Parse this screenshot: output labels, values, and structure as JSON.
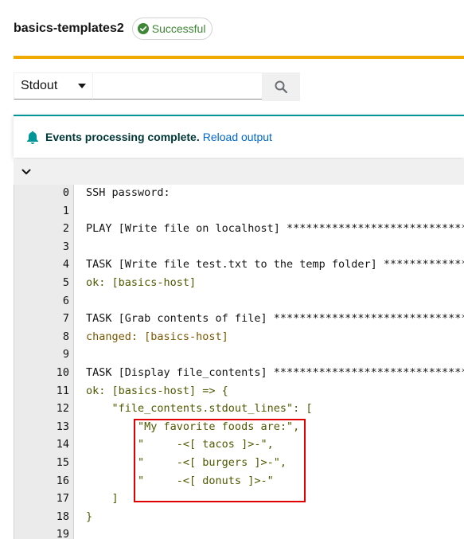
{
  "header": {
    "title": "basics-templates2",
    "status": "Successful"
  },
  "colors": {
    "success": "#3e8635",
    "progress": "#f0ab00",
    "alert_accent": "#009596",
    "link": "#0066cc",
    "highlight": "#e00000"
  },
  "toolbar": {
    "filter_selected": "Stdout",
    "search_value": ""
  },
  "alert": {
    "title": "Events processing complete.",
    "link": "Reload output"
  },
  "output": {
    "lines": [
      {
        "n": "0",
        "text": "SSH password:",
        "style": "default"
      },
      {
        "n": "1",
        "text": "",
        "style": "default"
      },
      {
        "n": "2",
        "text": "PLAY [Write file on localhost] ******************************************",
        "style": "default"
      },
      {
        "n": "3",
        "text": "",
        "style": "default"
      },
      {
        "n": "4",
        "text": "TASK [Write file test.txt to the temp folder] ****************************",
        "style": "default"
      },
      {
        "n": "5",
        "text": "ok: [basics-host]",
        "style": "ok"
      },
      {
        "n": "6",
        "text": "",
        "style": "default"
      },
      {
        "n": "7",
        "text": "TASK [Grab contents of file] ********************************************",
        "style": "default"
      },
      {
        "n": "8",
        "text": "changed: [basics-host]",
        "style": "changed"
      },
      {
        "n": "9",
        "text": "",
        "style": "default"
      },
      {
        "n": "10",
        "text": "TASK [Display file_contents] *********************************************",
        "style": "default"
      },
      {
        "n": "11",
        "text": "ok: [basics-host] => {",
        "style": "ok"
      },
      {
        "n": "12",
        "text": "    \"file_contents.stdout_lines\": [",
        "style": "ok"
      },
      {
        "n": "13",
        "text": "        \"My favorite foods are:\",",
        "style": "ok"
      },
      {
        "n": "14",
        "text": "        \"     -<[ tacos ]>-\",",
        "style": "ok"
      },
      {
        "n": "15",
        "text": "        \"     -<[ burgers ]>-\",",
        "style": "ok"
      },
      {
        "n": "16",
        "text": "        \"     -<[ donuts ]>-\"",
        "style": "ok"
      },
      {
        "n": "17",
        "text": "    ]",
        "style": "ok"
      },
      {
        "n": "18",
        "text": "}",
        "style": "ok"
      },
      {
        "n": "19",
        "text": "",
        "style": "default"
      }
    ]
  }
}
